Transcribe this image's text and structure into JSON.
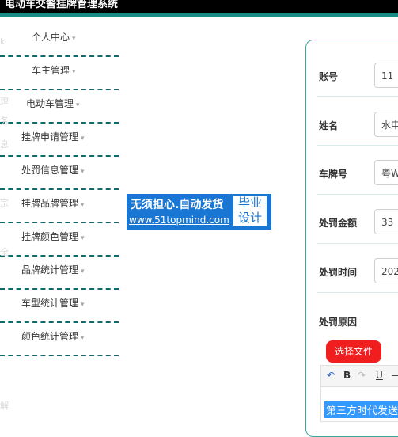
{
  "header": {
    "title": "电动车交警挂牌管理系统"
  },
  "sidebar": {
    "items": [
      {
        "label": "个人中心"
      },
      {
        "label": "车主管理"
      },
      {
        "label": "电动车管理"
      },
      {
        "label": "挂牌申请管理"
      },
      {
        "label": "处罚信息管理"
      },
      {
        "label": "挂牌品牌管理"
      },
      {
        "label": "挂牌颜色管理"
      },
      {
        "label": "品牌统计管理"
      },
      {
        "label": "车型统计管理"
      },
      {
        "label": "颜色统计管理"
      }
    ],
    "caret": "▾",
    "ghost_chars": [
      "k",
      "理",
      "务",
      "息",
      "宗",
      "全",
      "解"
    ]
  },
  "watermark": {
    "line1": "无须担心.自动发货",
    "line2": "www.51topmind.com",
    "box1": "毕业",
    "box2": "设计"
  },
  "form": {
    "rows": [
      {
        "label": "账号",
        "value": "11"
      },
      {
        "label": "姓名",
        "value": "水申"
      },
      {
        "label": "车牌号",
        "value": "粤W"
      },
      {
        "label": "处罚金额",
        "value": "33"
      },
      {
        "label": "处罚时间",
        "value": "202"
      },
      {
        "label": "处罚原因",
        "value": ""
      }
    ],
    "file_button": "选择文件",
    "toolbar": {
      "undo": "↶",
      "bold": "B",
      "redo": "↷",
      "underline": "U",
      "dash": "—"
    },
    "editor_selected_text": "第三方时代发送"
  }
}
